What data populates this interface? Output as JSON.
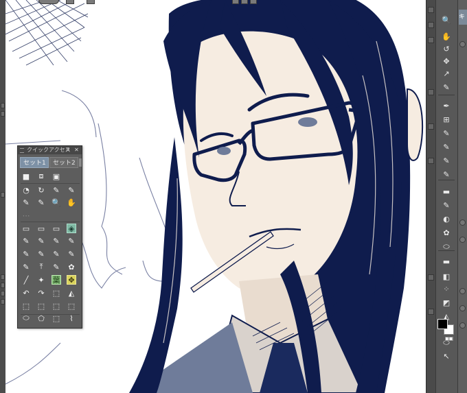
{
  "app": {
    "quick_access": {
      "title": "クイックアクセス",
      "tabs": [
        "セット1",
        "セット2"
      ],
      "rows": [
        [
          "■",
          "⧈",
          "▣"
        ],
        [
          "◔",
          "↻",
          "✎",
          "✎"
        ],
        [
          "✎",
          "✎",
          "🔍",
          "✋"
        ],
        [
          "⋯"
        ],
        [
          "▭",
          "▭",
          "▭",
          "◈"
        ],
        [
          "✎",
          "✎",
          "✎",
          "✎"
        ],
        [
          "✎",
          "✎",
          "✎",
          "✎"
        ],
        [
          "✎",
          "⤒",
          "✎",
          "✿"
        ],
        [
          "╱",
          "✦",
          "葉",
          "✥"
        ],
        [
          "↶",
          "↷",
          "⬚",
          "◭"
        ],
        [
          "⬚",
          "⬚",
          "⬚",
          "⬚"
        ],
        [
          "⬭",
          "⬠",
          "⬚",
          "⌇"
        ]
      ]
    },
    "right_panel_tab": "キャ",
    "toolbar_right": [
      "🔍",
      "✋",
      "↺",
      "✥",
      "↗",
      "✎",
      "✒",
      "⊞",
      "✎",
      "✎",
      "✎",
      "✎",
      "▬",
      "✎",
      "◐",
      "✿",
      "⬭",
      "▬",
      "◧",
      "⁘",
      "◩",
      "◭",
      "A",
      "⬭",
      "↖"
    ],
    "colors": {
      "canvas_bg": "#ffffff",
      "ink": "#0f1c4d",
      "skin": "#f6ece1",
      "ui_bg": "#5a5a5a",
      "accent_tab": "#7d91a6",
      "foreground_color": "#000000",
      "background_color": "#ffffff"
    },
    "icons": {
      "close": "close-icon",
      "menu": "menu-icon",
      "grip": "grip-icon"
    }
  }
}
